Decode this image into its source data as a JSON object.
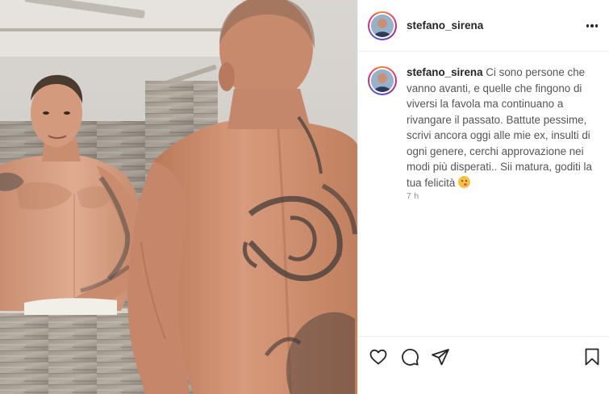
{
  "post": {
    "username": "stefano_sirena",
    "caption_username": "stefano_sirena",
    "caption_text": "Ci sono persone che vanno avanti, e quelle che fingono di viversi la favola ma continuano a rivangare il passato. Battute pessime, scrivi ancora oggi alle mie ex, insulti di ogni genere, cerchi approvazione nei modi più disperati.. Sii matura, goditi la tua felicità",
    "caption_emoji": "smiling-face-emoji",
    "timestamp": "7 h"
  },
  "icons": {
    "more": "more-options-icon",
    "like": "heart-icon",
    "comment": "comment-icon",
    "share": "send-icon",
    "save": "bookmark-icon"
  },
  "colors": {
    "text_primary": "#262626",
    "text_secondary": "#8e8e8e",
    "divider": "#efefef",
    "story_ring": [
      "#f58529",
      "#dd2a7b",
      "#8134af",
      "#515bd4"
    ]
  }
}
